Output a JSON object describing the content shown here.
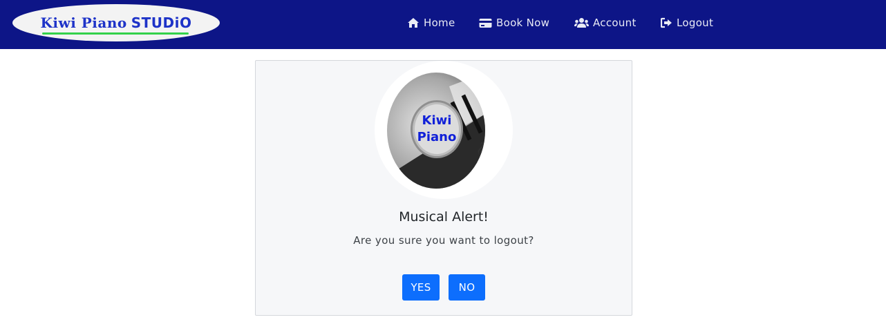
{
  "brand": {
    "name": "Kiwi Piano",
    "studio": "STUDiO"
  },
  "nav": {
    "items": [
      {
        "label": "Home",
        "icon": "home-icon"
      },
      {
        "label": "Book Now",
        "icon": "credit-card-icon"
      },
      {
        "label": "Account",
        "icon": "users-icon"
      },
      {
        "label": "Logout",
        "icon": "sign-out-icon"
      }
    ]
  },
  "dialog": {
    "logo": {
      "line1": "Kiwi",
      "line2": "Piano"
    },
    "title": "Musical Alert!",
    "message": "Are you sure you want to logout?",
    "yes_label": "YES",
    "no_label": "NO"
  },
  "colors": {
    "navbar": "#0d1587",
    "button": "#0d6efd",
    "card": "#f6f7f9"
  }
}
